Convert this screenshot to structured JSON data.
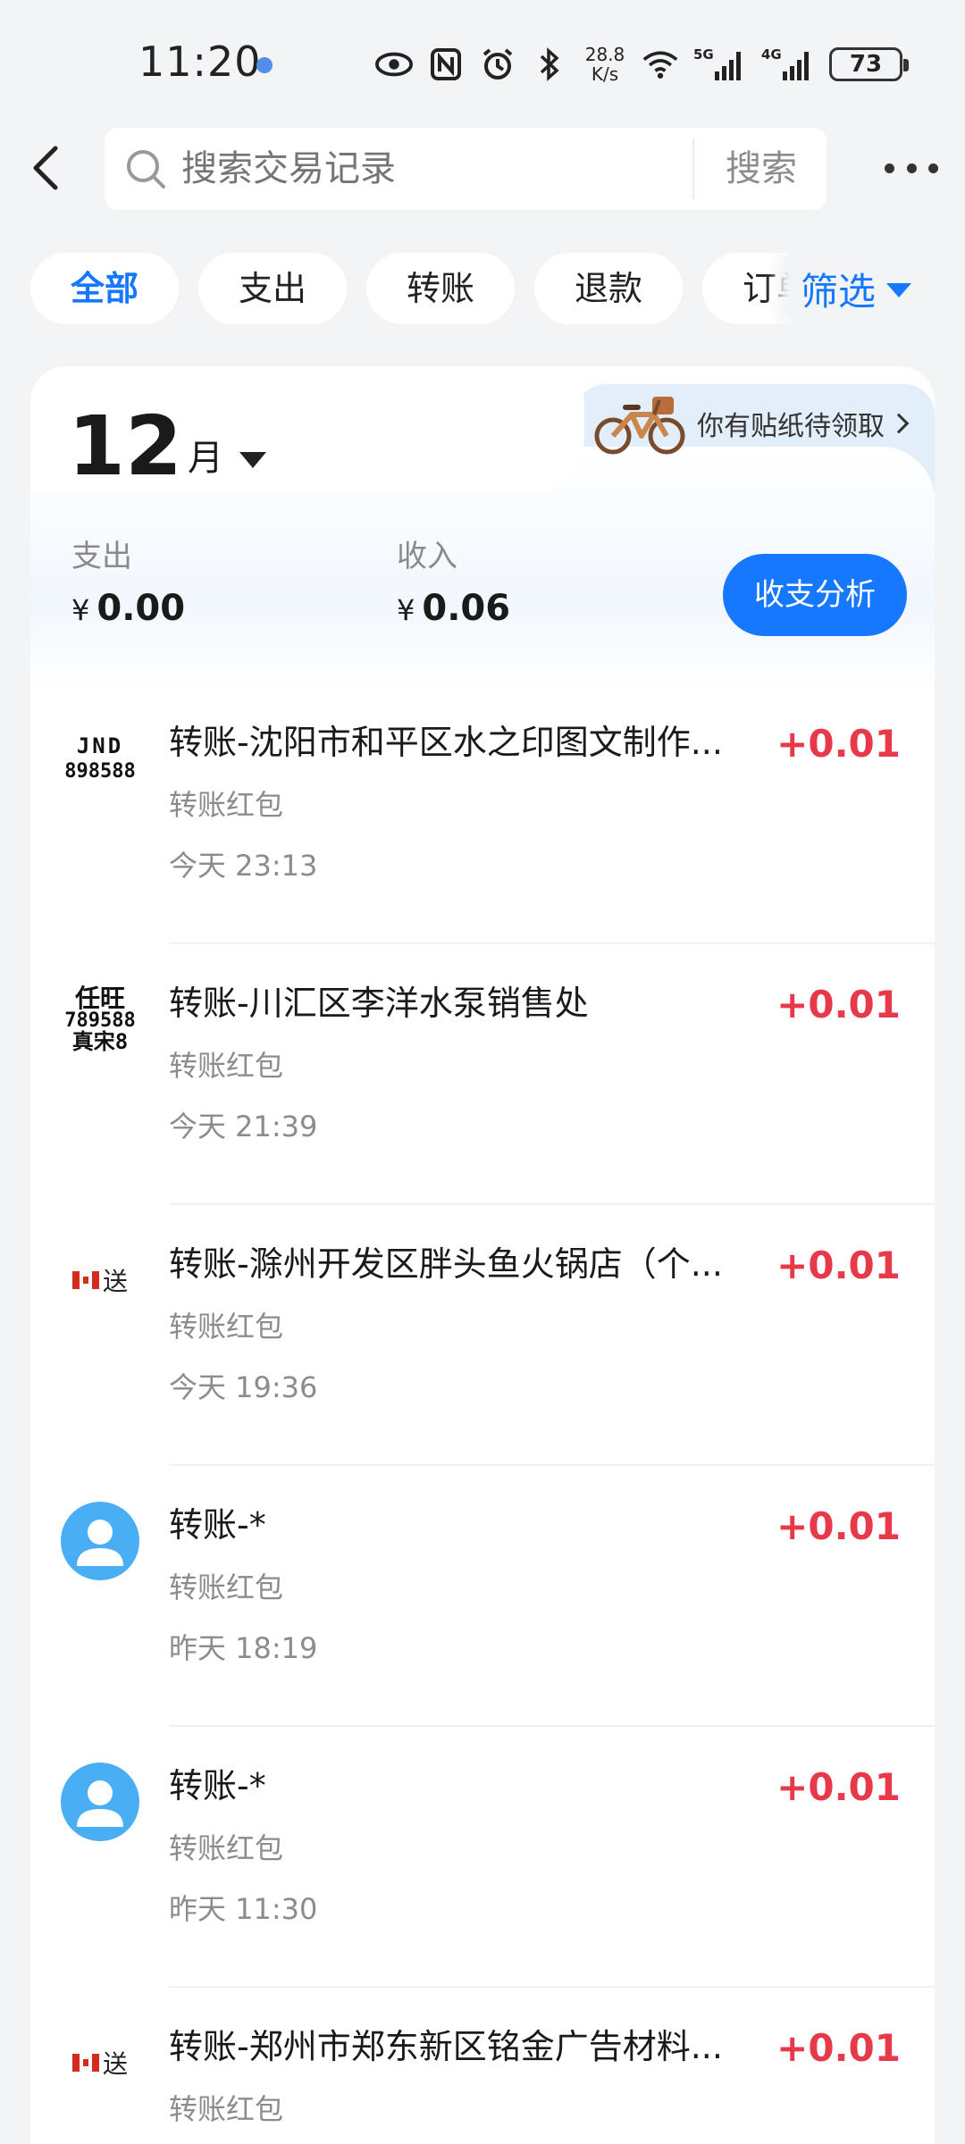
{
  "status_bar": {
    "time": "11:20",
    "net_speed_value": "28.8",
    "net_speed_unit": "K/s",
    "signal_1": "5G",
    "signal_2": "4G",
    "battery": "73"
  },
  "search": {
    "placeholder": "搜索交易记录",
    "button_label": "搜索"
  },
  "filters": {
    "tabs": [
      {
        "label": "全部",
        "active": true
      },
      {
        "label": "支出",
        "active": false
      },
      {
        "label": "转账",
        "active": false
      },
      {
        "label": "退款",
        "active": false
      },
      {
        "label": "订单",
        "active": false
      }
    ],
    "filter_label": "筛选"
  },
  "summary": {
    "month_number": "12",
    "month_unit": "月",
    "sticker_promo": "你有贴纸待领取",
    "expense_label": "支出",
    "expense_currency": "¥",
    "expense_value": "0.00",
    "income_label": "收入",
    "income_currency": "¥",
    "income_value": "0.06",
    "analysis_button": "收支分析"
  },
  "transactions": [
    {
      "title": "转账-沈阳市和平区水之印图文制作...",
      "subtitle": "转账红包",
      "time": "今天 23:13",
      "amount": "+0.01",
      "logo": "jnd",
      "logo_text_1": "JND",
      "logo_text_2": "898588"
    },
    {
      "title": "转账-川汇区李洋水泵销售处",
      "subtitle": "转账红包",
      "time": "今天 21:39",
      "amount": "+0.01",
      "logo": "renwang",
      "logo_text_1": "任旺",
      "logo_text_2": "789588",
      "logo_text_3": "真宋8"
    },
    {
      "title": "转账-滁州开发区胖头鱼火锅店（个...",
      "subtitle": "转账红包",
      "time": "今天 19:36",
      "amount": "+0.01",
      "logo": "flag",
      "logo_text_1": "送"
    },
    {
      "title": "转账-*",
      "subtitle": "转账红包",
      "time": "昨天 18:19",
      "amount": "+0.01",
      "logo": "person"
    },
    {
      "title": "转账-*",
      "subtitle": "转账红包",
      "time": "昨天 11:30",
      "amount": "+0.01",
      "logo": "person"
    },
    {
      "title": "转账-郑州市郑东新区铭金广告材料...",
      "subtitle": "转账红包",
      "time": "",
      "amount": "+0.01",
      "logo": "flag",
      "logo_text_1": "送"
    }
  ],
  "colors": {
    "accent": "#1677ff",
    "income_red": "#e8394a",
    "background": "#f3f4f6",
    "avatar_blue": "#4aaef5"
  }
}
